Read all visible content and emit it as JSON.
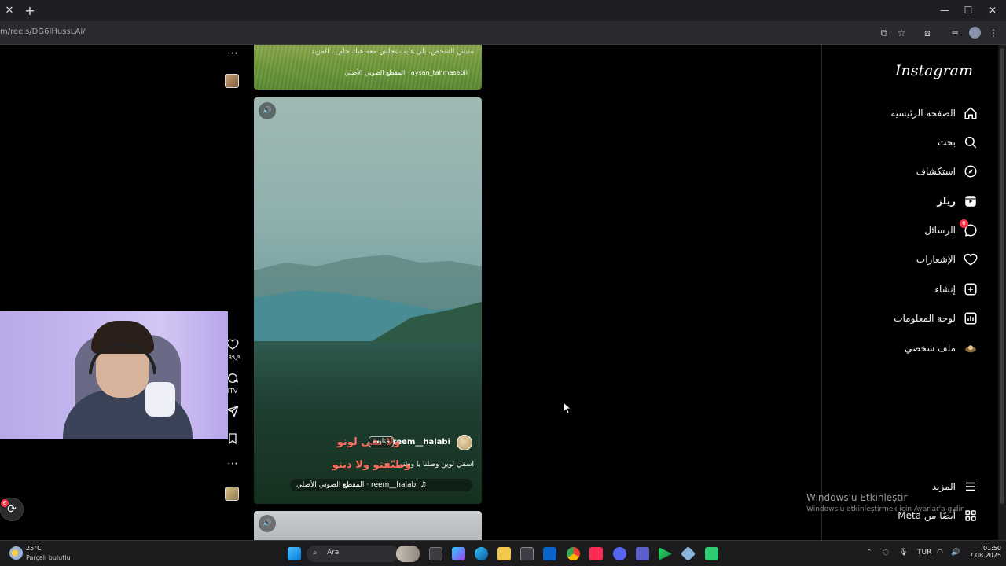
{
  "browser": {
    "url": "m/reels/DG6IHussLAi/"
  },
  "instagram": {
    "logo": "Instagram",
    "nav": [
      {
        "label": "الصفحة الرئيسية",
        "icon": "home-icon"
      },
      {
        "label": "بحث",
        "icon": "search-icon"
      },
      {
        "label": "استكشاف",
        "icon": "compass-icon"
      },
      {
        "label": "ريلز",
        "icon": "reels-icon"
      },
      {
        "label": "الرسائل",
        "icon": "messenger-icon",
        "badge": "6"
      },
      {
        "label": "الإشعارات",
        "icon": "heart-icon"
      },
      {
        "label": "إنشاء",
        "icon": "create-icon"
      },
      {
        "label": "لوحة المعلومات",
        "icon": "dashboard-icon"
      },
      {
        "label": "ملف شخصي",
        "icon": "profile-avatar-icon"
      }
    ],
    "more": {
      "label": "المزيد"
    },
    "also_meta": {
      "label": "أيضًا من Meta"
    }
  },
  "reel_top": {
    "caption": "منيش الشخص، يلي غايب تجلس معه هيك حلم... المزيد",
    "audio": "aysan_tahmasebii · المقطع الصوتي الأصلي"
  },
  "reel_main": {
    "username": "reem__halabi",
    "follow_label": "متابعة",
    "overlay_line1": "ولا نقى لونو",
    "overlay_line2": "وطيّفتو ولا دينو",
    "caption": "اسقي لوين وصلنا يا وطني",
    "audio": "reem__halabi · المقطع الصوتي الأصلي"
  },
  "actions": {
    "likes": "٩٩٫٩ أ",
    "comments": "ITV"
  },
  "floating_messages": {
    "badge": "6"
  },
  "watermark": {
    "line1": "Windows'u Etkinleştir",
    "line2": "Windows'u etkinleştirmek için Ayarlar'a gidin."
  },
  "taskbar": {
    "temperature": "25°C",
    "weather": "Parçalı bulutlu",
    "search_placeholder": "Ara",
    "language": "TUR",
    "time": "01:50",
    "date": "7.08.2025"
  },
  "colors": {
    "accent_badge": "#ff3040",
    "overlay_text": "#ff6b5c",
    "background": "#000000"
  }
}
